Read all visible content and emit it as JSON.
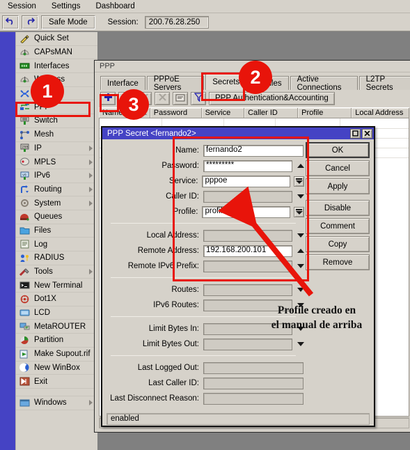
{
  "menubar": {
    "items": [
      "Session",
      "Settings",
      "Dashboard"
    ]
  },
  "toolbar": {
    "undo_icon": "undo-arrow-icon",
    "redo_icon": "redo-arrow-icon",
    "safe_mode_label": "Safe Mode",
    "session_label": "Session:",
    "session_value": "200.76.28.250"
  },
  "sidebar": {
    "items": [
      {
        "label": "Quick Set",
        "icon": "wand-icon",
        "submenu": false
      },
      {
        "label": "CAPsMAN",
        "icon": "antenna-icon",
        "submenu": false
      },
      {
        "label": "Interfaces",
        "icon": "network-card-icon",
        "submenu": false
      },
      {
        "label": "Wireless",
        "icon": "antenna-icon",
        "submenu": false
      },
      {
        "label": "Bridge",
        "icon": "bridge-icon",
        "submenu": false
      },
      {
        "label": "PPP",
        "icon": "ppp-icon",
        "submenu": false
      },
      {
        "label": "Switch",
        "icon": "switch-icon",
        "submenu": false
      },
      {
        "label": "Mesh",
        "icon": "mesh-icon",
        "submenu": false
      },
      {
        "label": "IP",
        "icon": "ip-icon",
        "submenu": true
      },
      {
        "label": "MPLS",
        "icon": "mpls-icon",
        "submenu": true
      },
      {
        "label": "IPv6",
        "icon": "ipv6-icon",
        "submenu": true
      },
      {
        "label": "Routing",
        "icon": "routing-icon",
        "submenu": true
      },
      {
        "label": "System",
        "icon": "gear-icon",
        "submenu": true
      },
      {
        "label": "Queues",
        "icon": "queues-icon",
        "submenu": false
      },
      {
        "label": "Files",
        "icon": "folder-icon",
        "submenu": false
      },
      {
        "label": "Log",
        "icon": "log-icon",
        "submenu": false
      },
      {
        "label": "RADIUS",
        "icon": "radius-key-icon",
        "submenu": false
      },
      {
        "label": "Tools",
        "icon": "tools-icon",
        "submenu": true
      },
      {
        "label": "New Terminal",
        "icon": "terminal-icon",
        "submenu": false
      },
      {
        "label": "Dot1X",
        "icon": "dot1x-icon",
        "submenu": false
      },
      {
        "label": "LCD",
        "icon": "lcd-icon",
        "submenu": false
      },
      {
        "label": "MetaROUTER",
        "icon": "metarouter-icon",
        "submenu": false
      },
      {
        "label": "Partition",
        "icon": "partition-icon",
        "submenu": false
      },
      {
        "label": "Make Supout.rif",
        "icon": "supout-icon",
        "submenu": false
      },
      {
        "label": "New WinBox",
        "icon": "winbox-icon",
        "submenu": false
      },
      {
        "label": "Exit",
        "icon": "exit-icon",
        "submenu": false
      }
    ],
    "windows_item": {
      "label": "Windows",
      "icon": "window-icon",
      "submenu": true
    }
  },
  "ppp_window": {
    "title": "PPP",
    "tabs": [
      {
        "label": "Interface",
        "active": false
      },
      {
        "label": "PPPoE Servers",
        "active": false
      },
      {
        "label": "Secrets",
        "active": true
      },
      {
        "label": "Profiles",
        "active": false
      },
      {
        "label": "Active Connections",
        "active": false
      },
      {
        "label": "L2TP Secrets",
        "active": false
      }
    ],
    "toolbar": {
      "add_icon": "plus-icon",
      "remove_icon": "minus-icon",
      "enable_icon": "check-icon",
      "disable_icon": "cross-icon",
      "comment_icon": "comment-icon",
      "filter_icon": "funnel-icon",
      "auth_button_label": "PPP Authentication&Accounting"
    },
    "table": {
      "columns": [
        "Name",
        "Password",
        "Service",
        "Caller ID",
        "Profile",
        "Local Address"
      ],
      "sorted_column": "Name",
      "rows": []
    }
  },
  "dialog": {
    "title": "PPP Secret <fernando2>",
    "maximize_icon": "maximize-icon",
    "close_icon": "close-icon",
    "fields": [
      {
        "label": "Name:",
        "value": "fernando2",
        "readonly": false,
        "control": "none"
      },
      {
        "label": "Password:",
        "value": "*********",
        "readonly": false,
        "control": "caret-up"
      },
      {
        "label": "Service:",
        "value": "pppoe",
        "readonly": false,
        "control": "spin-down"
      },
      {
        "label": "Caller ID:",
        "value": "",
        "readonly": true,
        "control": "caret-down"
      },
      {
        "label": "Profile:",
        "value": "profile1",
        "readonly": false,
        "control": "spin-down"
      },
      {
        "label": "Local Address:",
        "value": "",
        "readonly": true,
        "control": "caret-down"
      },
      {
        "label": "Remote Address:",
        "value": "192.168.200.101",
        "readonly": false,
        "control": "caret-up"
      },
      {
        "label": "Remote IPv6 Prefix:",
        "value": "",
        "readonly": true,
        "control": "caret-down"
      },
      {
        "label": "Routes:",
        "value": "",
        "readonly": true,
        "control": "caret-down"
      },
      {
        "label": "IPv6 Routes:",
        "value": "",
        "readonly": true,
        "control": "caret-down"
      },
      {
        "label": "Limit Bytes In:",
        "value": "",
        "readonly": true,
        "control": "caret-down"
      },
      {
        "label": "Limit Bytes Out:",
        "value": "",
        "readonly": true,
        "control": "caret-down"
      },
      {
        "label": "Last Logged Out:",
        "value": "",
        "readonly": true,
        "control": "none"
      },
      {
        "label": "Last Caller ID:",
        "value": "",
        "readonly": true,
        "control": "none"
      },
      {
        "label": "Last Disconnect Reason:",
        "value": "",
        "readonly": true,
        "control": "none"
      }
    ],
    "buttons": [
      "OK",
      "Cancel",
      "Apply",
      "Disable",
      "Comment",
      "Copy",
      "Remove"
    ],
    "status": "enabled"
  },
  "annotations": {
    "badges": [
      "1",
      "2",
      "3"
    ],
    "note_line1": "Profile creado en",
    "note_line2": "el manual de arriba",
    "accent_color": "#e8140a"
  }
}
